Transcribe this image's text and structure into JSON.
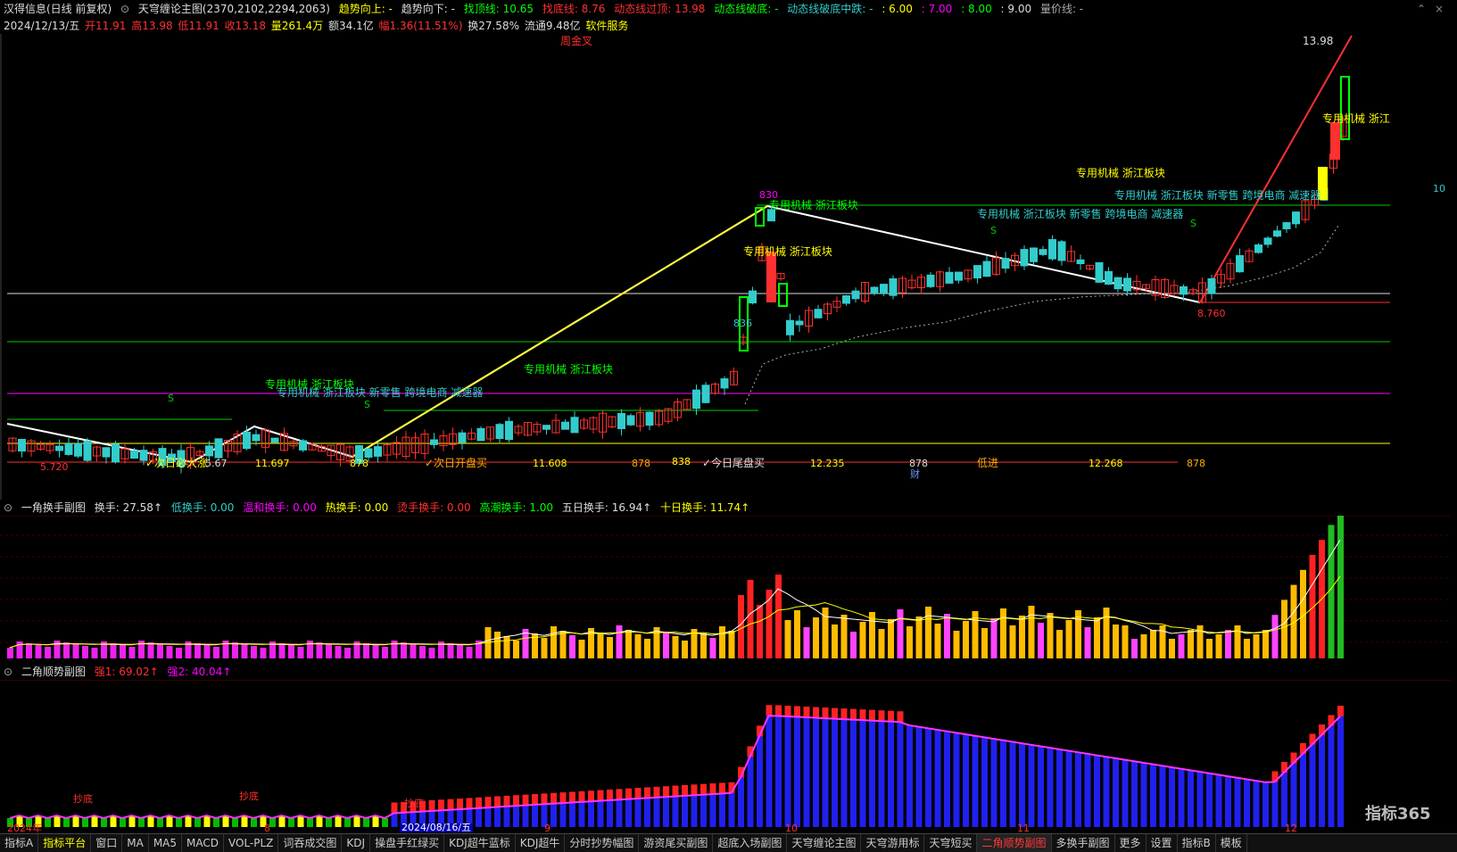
{
  "header": {
    "stock": "汉得信息(日线 前复权)",
    "indicator_name": "天穹缠论主图(2370,2102,2294,2063)",
    "trend_up_label": "趋势向上: -",
    "trend_down_label": "趋势向下: -",
    "top_line": "找顶线: 10.65",
    "bottom_line": "找底线: 8.76",
    "dyn_break_top": "动态线过顶: 13.98",
    "dyn_bottom": "动态线破底: -",
    "dyn_mid": "动态线破底中跌: -",
    "v1": ": 6.00",
    "v2": ": 7.00",
    "v3": ": 8.00",
    "v4": ": 9.00",
    "vol_price": "量价线: -"
  },
  "quote": {
    "date": "2024/12/13/五",
    "open": "开11.91",
    "high": "高13.98",
    "low": "低11.91",
    "close": "收13.18",
    "vol": "量261.4万",
    "amount": "额34.1亿",
    "change": "幅1.36(11.51%)",
    "turnover": "换27.58%",
    "float": "流通9.48亿",
    "sector": "软件服务"
  },
  "main_labels": {
    "weekly_cross": "周金叉",
    "high_price": "13.98",
    "low_price": "8.760",
    "p_830": "830",
    "p_low1": "5.720",
    "p_567": "5.67",
    "p_11697": "11.697",
    "p_878a": "878",
    "next_day_rise": "✓次日必大涨",
    "next_open_buy": "✓次日开盘买",
    "p_11608": "11.608",
    "p_878b": "878",
    "p_838": "838",
    "today_close_buy": "✓今日尾盘买",
    "p_12235": "12.235",
    "p_878c": "878",
    "cai": "财",
    "low_in": "低进",
    "p_12268": "12.268",
    "p_878d": "878",
    "sec1": "专用机械 浙江板块",
    "sec2": "专用机械 浙江板块 新零售 跨境电商 减速器",
    "sec3": "专用机械 浙江板块",
    "sec4": "专用机械 浙江板块",
    "sec5": "专用机械 浙江板块",
    "sec6": "专用机械 浙江板块 新零售 跨境电商 减速器",
    "sec7": "专用机械 浙江板块 新零售 跨境电商 减速器",
    "sec8": "专用机械 浙江",
    "s_mark": "S",
    "p_836": "836",
    "p_8": "8",
    "p_7": "7",
    "right_edge": "10"
  },
  "sub1": {
    "name": "一角换手副图",
    "turnover": "换手: 27.58↑",
    "low": "低换手: 0.00",
    "mild": "温和换手: 0.00",
    "hot": "热换手: 0.00",
    "burn": "烫手换手: 0.00",
    "tide": "高潮换手: 1.00",
    "five": "五日换手: 16.94↑",
    "ten": "十日换手: 11.74↑"
  },
  "sub2": {
    "name": "二角顺势副图",
    "s1": "强1: 69.02↑",
    "s2": "强2: 40.04↑",
    "chaodi": "抄底"
  },
  "axis": {
    "year": "2024年",
    "m8": "8",
    "date_cursor": "2024/08/16/五",
    "m9": "9",
    "m10": "10",
    "m11": "11",
    "m12": "12"
  },
  "watermark": "指标365",
  "tabs": [
    "指标A",
    "指标平台",
    "窗口",
    "MA",
    "MA5",
    "MACD",
    "VOL-PLZ",
    "词吞成交图",
    "KDJ",
    "操盘手红绿买",
    "KDJ超牛蓝标",
    "KDJ超牛",
    "分时抄势幅图",
    "游资尾买副图",
    "超底入场副图",
    "天穹缠论主图",
    "天穹游用标",
    "天穹短买",
    "二角顺势副图",
    "多换手副图",
    "更多",
    "设置",
    "指标B",
    "模板"
  ],
  "colors": {
    "bg": "#000000",
    "up": "#ff3030",
    "down": "#33cccc",
    "yellow": "#ffff00",
    "green": "#00ff00",
    "magenta": "#ff00ff",
    "blue": "#2020ff",
    "orange": "#ffaa00"
  }
}
